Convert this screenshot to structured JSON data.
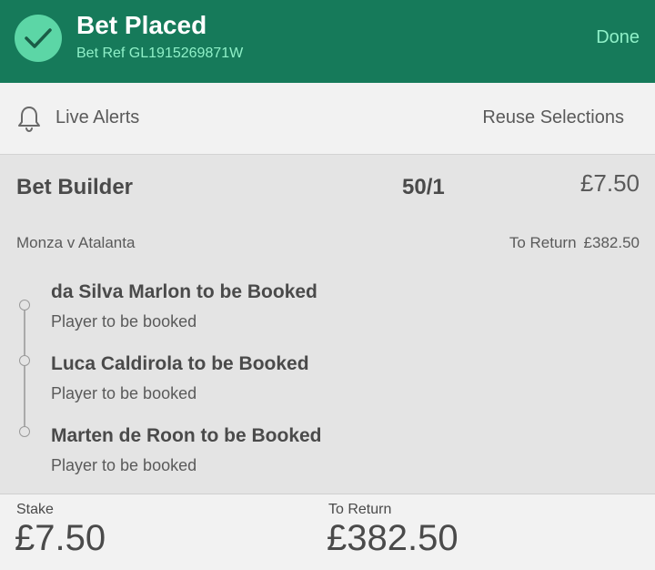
{
  "header": {
    "title": "Bet Placed",
    "bet_ref": "Bet Ref GL1915269871W",
    "done_label": "Done",
    "check_icon": "check-icon"
  },
  "actions": {
    "live_alerts_label": "Live Alerts",
    "reuse_label": "Reuse Selections",
    "bell_icon": "bell-icon"
  },
  "bet": {
    "type": "Bet Builder",
    "odds": "50/1",
    "stake": "£7.50",
    "match": "Monza v Atalanta",
    "to_return_label": "To Return",
    "to_return_value": "£382.50",
    "selections": [
      {
        "name": "da Silva Marlon to be Booked",
        "market": "Player to be booked"
      },
      {
        "name": "Luca Caldirola to be Booked",
        "market": "Player to be booked"
      },
      {
        "name": "Marten de Roon to be Booked",
        "market": "Player to be booked"
      }
    ]
  },
  "footer": {
    "stake_label": "Stake",
    "stake_value": "£7.50",
    "return_label": "To Return",
    "return_value": "£382.50"
  },
  "colors": {
    "header_bg": "#167a5a",
    "accent_green": "#5cd6a6",
    "link_green": "#8ff0c8"
  }
}
